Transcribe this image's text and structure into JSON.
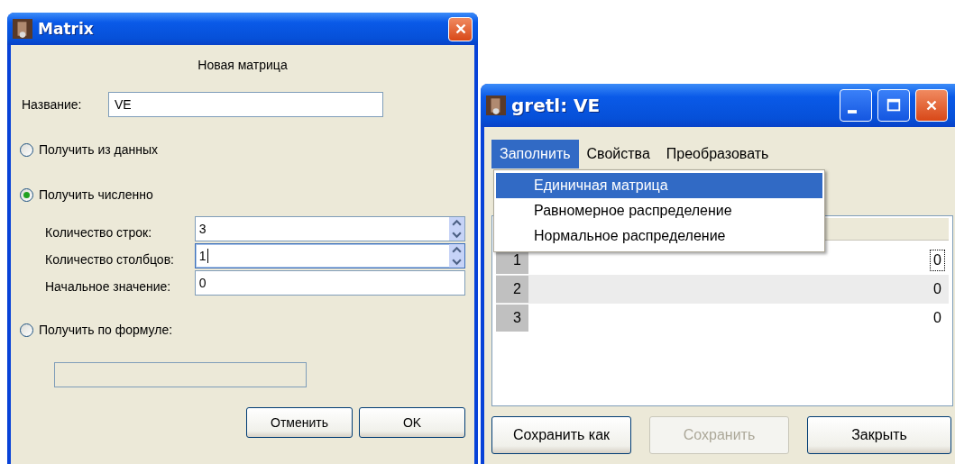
{
  "dialog": {
    "title": "Matrix",
    "heading": "Новая матрица",
    "name_label": "Название:",
    "name_value": "VE",
    "sources": [
      {
        "label": "Получить из данных",
        "selected": false
      },
      {
        "label": "Получить численно",
        "selected": true
      },
      {
        "label": "Получить по формуле:",
        "selected": false
      }
    ],
    "numeric_fields": [
      {
        "label": "Количество строк:",
        "value": "3",
        "kind": "spin",
        "focused": false
      },
      {
        "label": "Количество столбцов:",
        "value": "1",
        "kind": "spin",
        "focused": true
      },
      {
        "label": "Начальное значение:",
        "value": "0",
        "kind": "text",
        "focused": false
      }
    ],
    "formula": {
      "disabled": true
    },
    "buttons": [
      {
        "label": "Отменить"
      },
      {
        "label": "OK"
      }
    ]
  },
  "editor": {
    "title": "gretl: VE",
    "menus": [
      {
        "label": "Заполнить",
        "selected": true
      },
      {
        "label": "Свойства",
        "selected": false
      },
      {
        "label": "Преобразовать",
        "selected": false
      }
    ],
    "dropdown": [
      {
        "label": "Единичная матрица",
        "selected": true
      },
      {
        "label": "Равномерное распределение",
        "selected": false
      },
      {
        "label": "Нормальное распределение",
        "selected": false
      }
    ],
    "rows": [
      {
        "header": "1",
        "value": "0",
        "focused": true
      },
      {
        "header": "2",
        "value": "0",
        "focused": false
      },
      {
        "header": "3",
        "value": "0",
        "focused": false
      }
    ],
    "buttons": [
      {
        "label": "Сохранить как",
        "disabled": false
      },
      {
        "label": "Сохранить",
        "disabled": true
      },
      {
        "label": "Закрыть",
        "disabled": false
      }
    ]
  }
}
